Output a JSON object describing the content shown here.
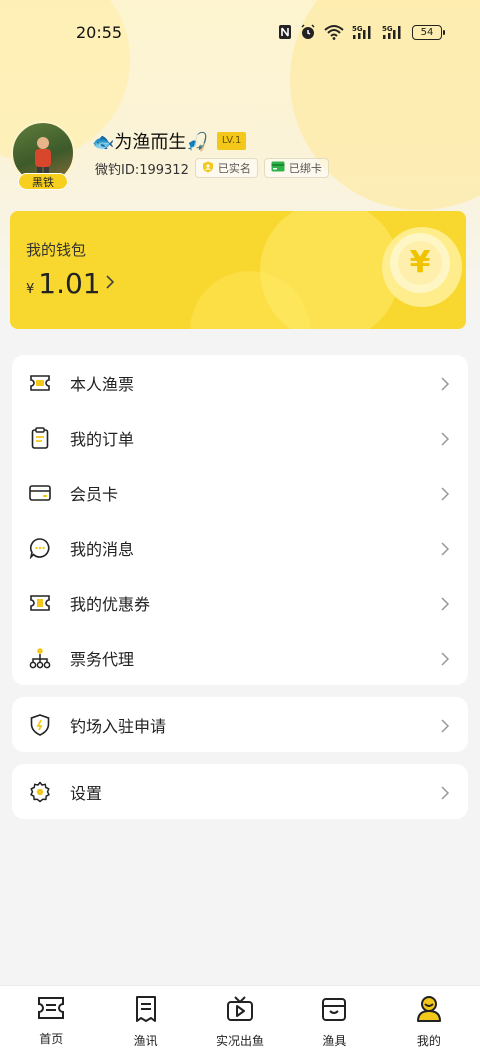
{
  "status_bar": {
    "time": "20:55",
    "battery": "54",
    "icons": [
      "nfc-icon",
      "alarm-icon",
      "wifi-icon",
      "signal-5g-icon",
      "signal-5g-icon",
      "battery-icon"
    ]
  },
  "profile": {
    "avatar_badge": "黑铁",
    "nickname": "🐟为渔而生🎣",
    "level": "LV.1",
    "user_id": "微钓ID:199312",
    "tags": [
      {
        "label": "已实名",
        "icon": "verified-icon"
      },
      {
        "label": "已绑卡",
        "icon": "card-icon"
      }
    ]
  },
  "wallet": {
    "title": "我的钱包",
    "currency": "¥",
    "amount": "1.01",
    "coin_symbol": "¥"
  },
  "menu_main": [
    {
      "label": "本人渔票",
      "icon": "ticket-icon"
    },
    {
      "label": "我的订单",
      "icon": "order-clipboard-icon"
    },
    {
      "label": "会员卡",
      "icon": "member-card-icon"
    },
    {
      "label": "我的消息",
      "icon": "message-bubble-icon"
    },
    {
      "label": "我的优惠券",
      "icon": "coupon-icon"
    },
    {
      "label": "票务代理",
      "icon": "agent-network-icon"
    }
  ],
  "menu_apply": [
    {
      "label": "钓场入驻申请",
      "icon": "shield-icon"
    }
  ],
  "menu_settings": [
    {
      "label": "设置",
      "icon": "gear-icon"
    }
  ],
  "bottom_nav": [
    {
      "label": "首页",
      "icon": "home-ticket-icon",
      "active": false
    },
    {
      "label": "渔讯",
      "icon": "news-icon",
      "active": false
    },
    {
      "label": "实况出鱼",
      "icon": "live-video-icon",
      "active": false
    },
    {
      "label": "渔具",
      "icon": "tackle-shop-icon",
      "active": false
    },
    {
      "label": "我的",
      "icon": "profile-person-icon",
      "active": true
    }
  ],
  "colors": {
    "accent": "#f8d82e",
    "badge": "#f3c81a",
    "background": "#f4f4f4"
  }
}
